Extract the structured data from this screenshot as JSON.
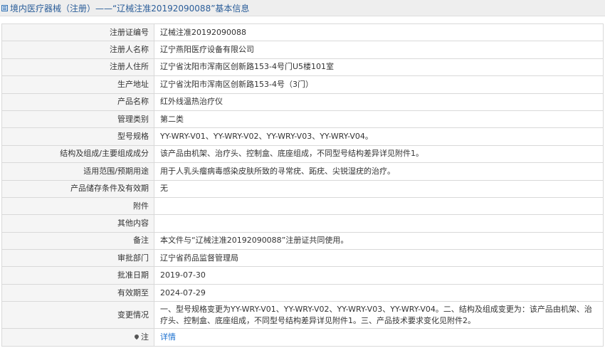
{
  "page": {
    "title": "境内医疗器械（注册）——“辽械注准20192090088”基本信息"
  },
  "rows": [
    {
      "label": "注册证编号",
      "value": "辽械注准20192090088"
    },
    {
      "label": "注册人名称",
      "value": "辽宁燕阳医疗设备有限公司"
    },
    {
      "label": "注册人住所",
      "value": "辽宁省沈阳市浑南区创新路153-4号门U5楼101室"
    },
    {
      "label": "生产地址",
      "value": "辽宁省沈阳市浑南区创新路153-4号（3门）"
    },
    {
      "label": "产品名称",
      "value": "红外线温热治疗仪"
    },
    {
      "label": "管理类别",
      "value": "第二类"
    },
    {
      "label": "型号规格",
      "value": "YY-WRY-V01、YY-WRY-V02、YY-WRY-V03、YY-WRY-V04。"
    },
    {
      "label": "结构及组成/主要组成成分",
      "value": "该产品由机架、治疗头、控制盒、底座组成，不同型号结构差异详见附件1。"
    },
    {
      "label": "适用范围/预期用途",
      "value": "用于人乳头瘤病毒感染皮肤所致的寻常疣、跖疣、尖锐湿疣的治疗。"
    },
    {
      "label": "产品储存条件及有效期",
      "value": "无"
    },
    {
      "label": "附件",
      "value": ""
    },
    {
      "label": "其他内容",
      "value": ""
    },
    {
      "label": "备注",
      "value": "本文件与“辽械注准20192090088”注册证共同使用。"
    },
    {
      "label": "审批部门",
      "value": "辽宁省药品监督管理局"
    },
    {
      "label": "批准日期",
      "value": "2019-07-30"
    },
    {
      "label": "有效期至",
      "value": "2024-07-29"
    },
    {
      "label": "变更情况",
      "value": "一、型号规格变更为YY-WRY-V01、YY-WRY-V02、YY-WRY-V03、YY-WRY-V04。二、结构及组成变更为：该产品由机架、治疗头、控制盒、底座组成，不同型号结构差异详见附件1。三、产品技术要求变化见附件2。"
    }
  ],
  "note": {
    "label": "注",
    "link_text": "详情",
    "icon": "map-pin-icon"
  },
  "colors": {
    "title": "#2a5d99",
    "label_bg": "#f5f5f5",
    "border": "#d9d9d9",
    "link": "#1a6fcf"
  }
}
